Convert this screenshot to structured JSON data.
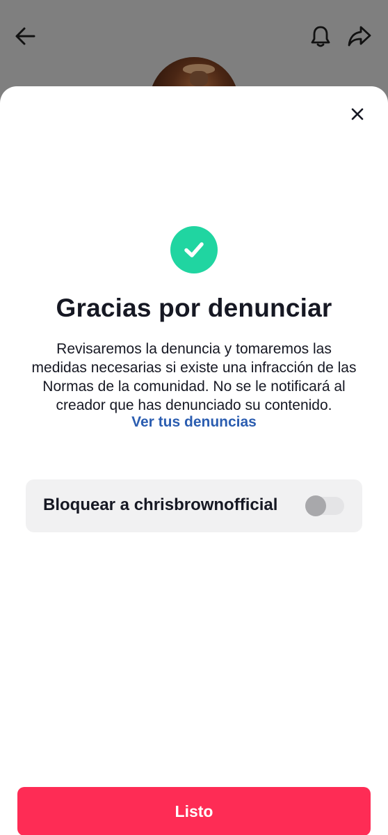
{
  "background": {
    "header": {
      "back_icon": "arrow-left-icon",
      "bell_icon": "bell-icon",
      "share_icon": "share-arrow-icon"
    }
  },
  "sheet": {
    "close_icon": "close-icon",
    "success_icon": "checkmark-circle-icon",
    "title": "Gracias por denunciar",
    "description": "Revisaremos la denuncia y tomaremos las medidas necesarias si existe una infracción de las Normas de la comunidad. No se le notificará al creador que has denunciado su contenido.",
    "link_label": "Ver tus denuncias",
    "block_option": {
      "label": "Bloquear a chrisbrownofficial",
      "toggle_on": false
    },
    "done_label": "Listo"
  },
  "colors": {
    "accent_red": "#fe2c55",
    "success_green": "#20d5a1",
    "link_blue": "#2b5db0",
    "overlay_gray": "#7f7f7f"
  }
}
